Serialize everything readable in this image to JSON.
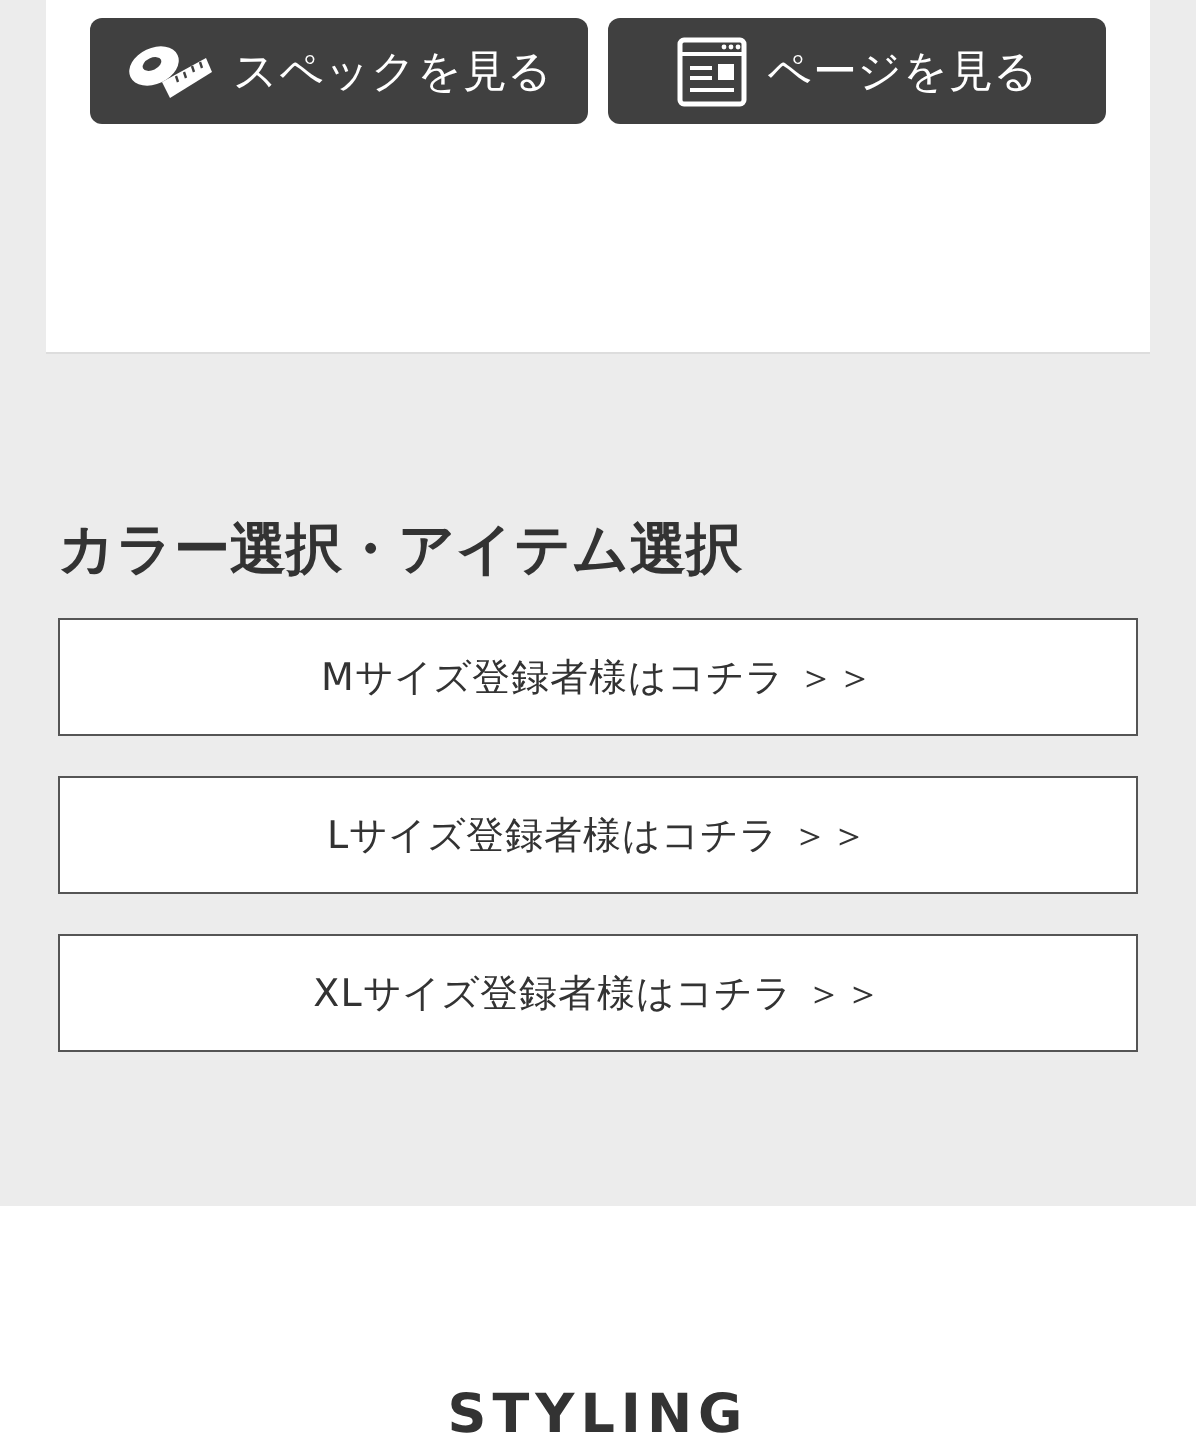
{
  "card_buttons": [
    {
      "kind": "spec",
      "label": "スペックを見る"
    },
    {
      "kind": "page",
      "label": "ページを見る"
    }
  ],
  "section": {
    "title": "カラー選択・アイテム選択",
    "links": [
      "Mサイズ登録者様はコチラ ＞＞",
      "Lサイズ登録者様はコチラ ＞＞",
      "XLサイズ登録者様はコチラ ＞＞"
    ]
  },
  "next_section": {
    "title": "STYLING"
  }
}
